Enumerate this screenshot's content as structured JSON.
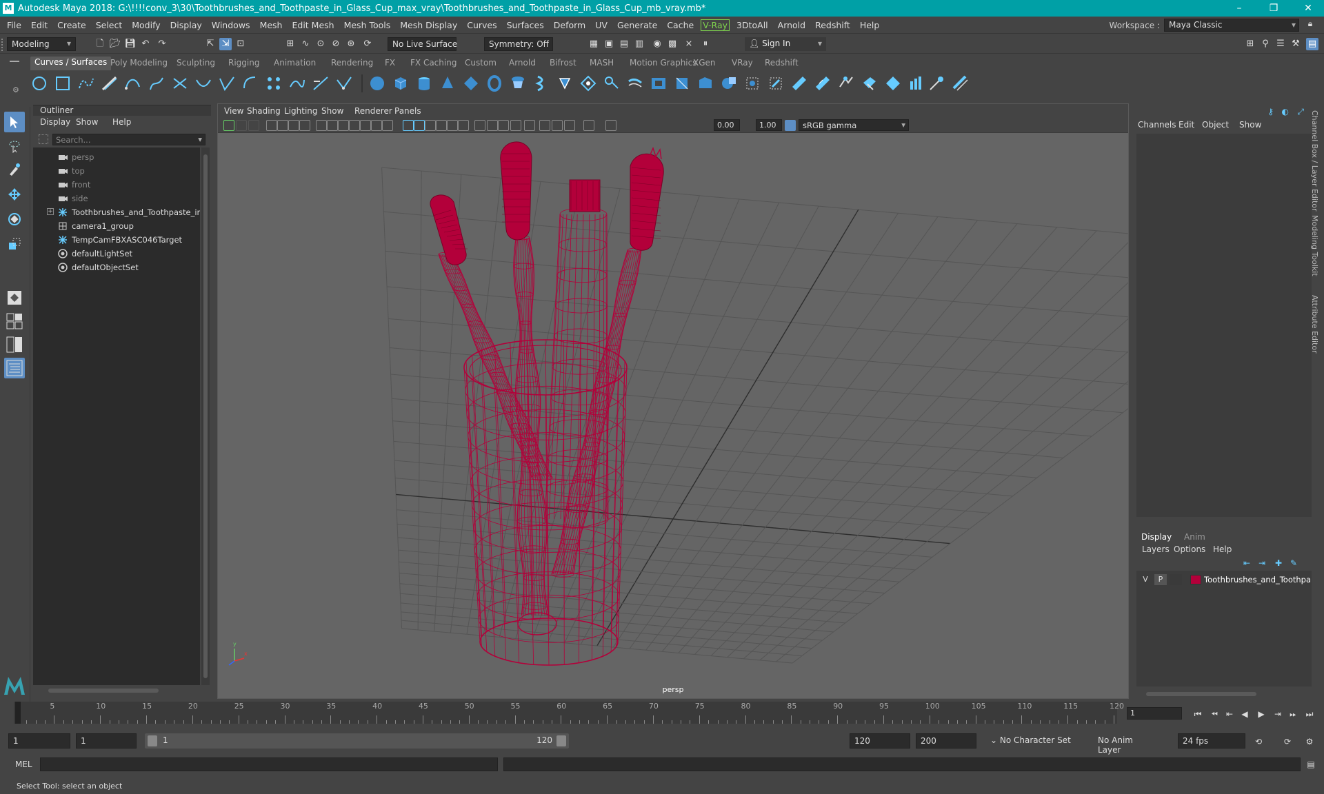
{
  "window": {
    "title": "Autodesk Maya 2018: G:\\!!!!conv_3\\30\\Toothbrushes_and_Toothpaste_in_Glass_Cup_max_vray\\Toothbrushes_and_Toothpaste_in_Glass_Cup_mb_vray.mb*",
    "controls": [
      "minimize",
      "maximize",
      "close"
    ]
  },
  "menubar": {
    "items": [
      "File",
      "Edit",
      "Create",
      "Select",
      "Modify",
      "Display",
      "Windows",
      "Mesh",
      "Edit Mesh",
      "Mesh Tools",
      "Mesh Display",
      "Curves",
      "Surfaces",
      "Deform",
      "UV",
      "Generate",
      "Cache",
      "V-Ray",
      "3DtoAll",
      "Arnold",
      "Redshift",
      "Help"
    ],
    "workspace_label": "Workspace :",
    "workspace_value": "Maya Classic"
  },
  "statusline": {
    "menu_set": "Modeling",
    "live_surface": "No Live Surface",
    "symmetry": "Symmetry: Off",
    "sign_in": "Sign In"
  },
  "shelf": {
    "tabs": [
      "Curves / Surfaces",
      "Poly Modeling",
      "Sculpting",
      "Rigging",
      "Animation",
      "Rendering",
      "FX",
      "FX Caching",
      "Custom",
      "Arnold",
      "Bifrost",
      "MASH",
      "Motion Graphics",
      "XGen",
      "VRay",
      "Redshift"
    ],
    "active_tab": "Curves / Surfaces"
  },
  "outliner": {
    "title": "Outliner",
    "menus": [
      "Display",
      "Show",
      "Help"
    ],
    "search_placeholder": "Search...",
    "items": [
      {
        "label": "persp",
        "icon": "camera-icon",
        "dim": true
      },
      {
        "label": "top",
        "icon": "camera-icon",
        "dim": true
      },
      {
        "label": "front",
        "icon": "camera-icon",
        "dim": true
      },
      {
        "label": "side",
        "icon": "camera-icon",
        "dim": true
      },
      {
        "label": "Toothbrushes_and_Toothpaste_in_Gl",
        "icon": "group-icon",
        "dim": false,
        "expandable": true
      },
      {
        "label": "camera1_group",
        "icon": "mesh-group-icon",
        "dim": false
      },
      {
        "label": "TempCamFBXASC046Target",
        "icon": "locator-icon",
        "dim": false
      },
      {
        "label": "defaultLightSet",
        "icon": "set-icon",
        "dim": false
      },
      {
        "label": "defaultObjectSet",
        "icon": "set-icon",
        "dim": false
      }
    ]
  },
  "viewport": {
    "menus": [
      "View",
      "Shading",
      "Lighting",
      "Show",
      "Renderer",
      "Panels"
    ],
    "exposure": "0.00",
    "gamma": "1.00",
    "color_space": "sRGB gamma",
    "camera": "persp",
    "wire_color": "#b3003a"
  },
  "channelbox": {
    "menus": [
      "Channels",
      "Edit",
      "Object",
      "Show"
    ],
    "side_tabs": [
      "Channel Box / Layer Editor",
      "Modeling Toolkit",
      "Attribute Editor"
    ]
  },
  "layereditor": {
    "tabs": [
      "Display",
      "Anim"
    ],
    "active_tab": "Display",
    "menus": [
      "Layers",
      "Options",
      "Help"
    ],
    "layer": {
      "v": "V",
      "p": "P",
      "name": "Toothbrushes_and_Toothpaste",
      "color": "#b3003a"
    }
  },
  "timeslider": {
    "ticks": [
      5,
      10,
      15,
      20,
      25,
      30,
      35,
      40,
      45,
      50,
      55,
      60,
      65,
      70,
      75,
      80,
      85,
      90,
      95,
      100,
      105,
      110,
      115,
      120
    ],
    "start_label": "1",
    "current_frame": "1"
  },
  "rangeslider": {
    "start": "1",
    "playback_start": "1",
    "range_start": "1",
    "range_end": "120",
    "playback_end": "120",
    "end": "200",
    "character_set": "No Character Set",
    "anim_layer": "No Anim Layer",
    "fps": "24 fps"
  },
  "cmdline": {
    "label": "MEL"
  },
  "helpline": {
    "text": "Select Tool: select an object"
  }
}
